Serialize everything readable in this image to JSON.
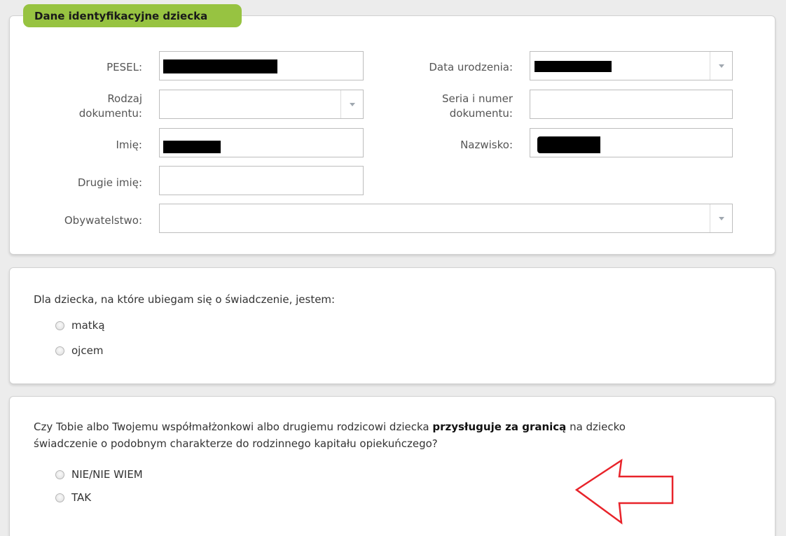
{
  "section1": {
    "title": "Dane identyfikacyjne dziecka",
    "fields": {
      "pesel_label": "PESEL:",
      "birthdate_label": "Data urodzenia:",
      "doctype_label_line1": "Rodzaj",
      "doctype_label_line2": "dokumentu:",
      "docnumber_label_line1": "Seria i numer",
      "docnumber_label_line2": "dokumentu:",
      "firstname_label": "Imię:",
      "lastname_label": "Nazwisko:",
      "secondname_label": "Drugie imię:",
      "citizenship_label": "Obywatelstwo:"
    }
  },
  "section2": {
    "question": "Dla dziecka, na które ubiegam się o świadczenie, jestem:",
    "options": [
      "matką",
      "ojcem"
    ]
  },
  "section3": {
    "question_part1": "Czy Tobie albo Twojemu współmałżonkowi albo drugiemu rodzicowi dziecka ",
    "question_bold": "przysługuje za granicą",
    "question_part2": " na dziecko",
    "question_line2": "świadczenie o podobnym charakterze do rodzinnego kapitału opiekuńczego?",
    "options": [
      "NIE/NIE WIEM",
      "TAK"
    ]
  },
  "colors": {
    "tag_background": "#97c341",
    "arrow": "#e8232a"
  },
  "icons": [
    "chevron-down-icon",
    "red-arrow-left-icon"
  ]
}
